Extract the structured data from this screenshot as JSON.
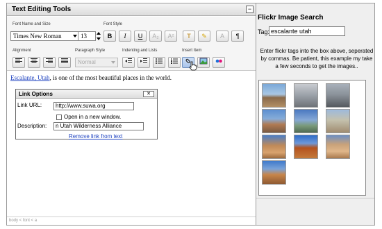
{
  "editor": {
    "title": "Text Editing Tools",
    "collapse_label": "−",
    "group_labels": {
      "font_name_size": "Font Name and Size",
      "font_style": "Font Style",
      "alignment": "Alignment",
      "paragraph_style": "Paragraph Style",
      "indenting": "Indenting and Lists",
      "insert_item": "Insert Item"
    },
    "font_name": "Times New Roman",
    "font_size": "13",
    "paragraph_style": "Normal",
    "buttons": {
      "bold": "B",
      "italic": "I",
      "underline": "U",
      "subscript": "A₂",
      "superscript": "A²",
      "clear_format": "T",
      "highlight": "✎",
      "font_color": "A",
      "show_source": "¶"
    },
    "content": {
      "link_text": "Escalante, Utah",
      "rest_text": ", is one of the most beautiful places in the world."
    },
    "status": "body < font < a"
  },
  "link_dialog": {
    "title": "Link Options",
    "close_label": "✕",
    "url_label": "Link URL:",
    "url_value": "http://www.suwa.org",
    "new_window_label": "Open in a new window.",
    "description_label": "Description:",
    "description_value": "n Utah Wilderness Alliance",
    "remove_link": "Remove link from text"
  },
  "flickr": {
    "title": "Flickr Image Search",
    "tag_label": "Tag:",
    "tag_value": "escalante utah",
    "help_text": "Enter flickr tags into the box above, seperated by commas. Be patient, this example my take a few seconds to get the images..",
    "images": [
      "thumb-1",
      "thumb-2",
      "thumb-3",
      "thumb-4",
      "thumb-5",
      "thumb-6",
      "thumb-7",
      "thumb-8",
      "thumb-9",
      "thumb-10"
    ]
  }
}
